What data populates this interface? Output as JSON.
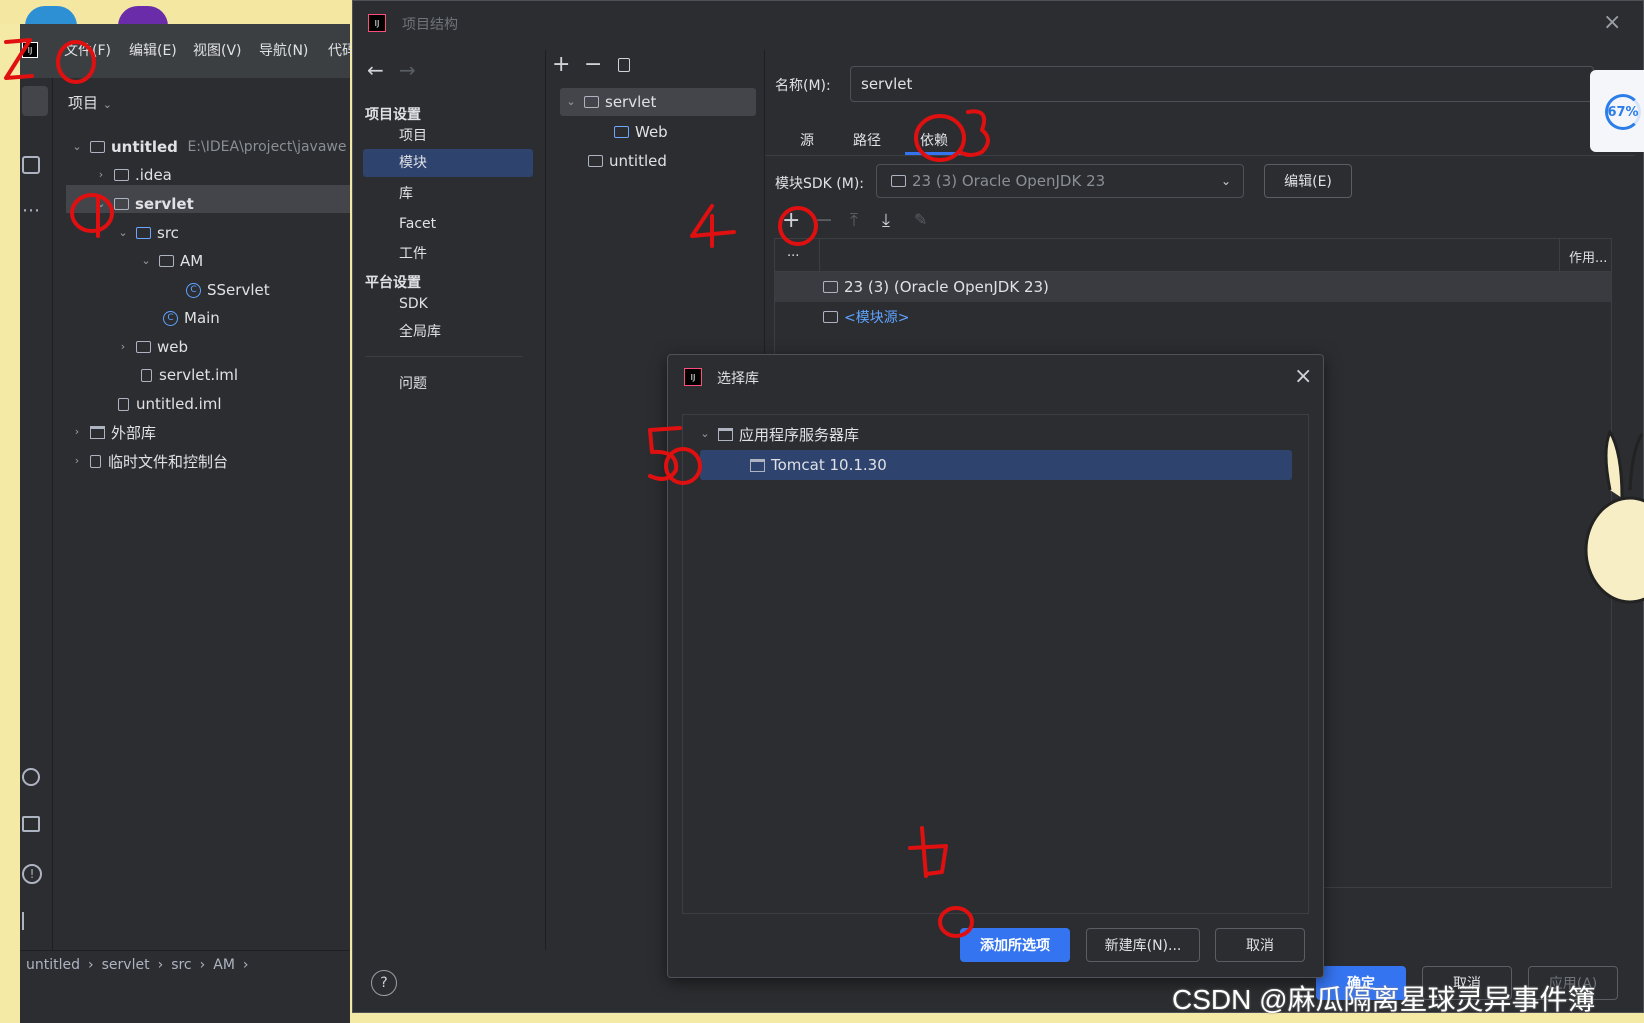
{
  "ide": {
    "menu": [
      "文件(F)",
      "编辑(E)",
      "视图(V)",
      "导航(N)",
      "代码"
    ],
    "project_label": "项目",
    "tree": [
      {
        "label": "untitled",
        "extra": "E:\\IDEA\\project\\javawe"
      },
      {
        "label": ".idea"
      },
      {
        "label": "servlet"
      },
      {
        "label": "src"
      },
      {
        "label": "AM"
      },
      {
        "label": "SServlet"
      },
      {
        "label": "Main"
      },
      {
        "label": "web"
      },
      {
        "label": "servlet.iml"
      },
      {
        "label": "untitled.iml"
      },
      {
        "label": "外部库"
      },
      {
        "label": "临时文件和控制台"
      }
    ],
    "breadcrumb": [
      "untitled",
      "servlet",
      "src",
      "AM"
    ]
  },
  "dialog": {
    "title": "项目结构",
    "project_settings_header": "项目设置",
    "project_settings": [
      "项目",
      "模块",
      "库",
      "Facet",
      "工件"
    ],
    "platform_settings_header": "平台设置",
    "platform_settings": [
      "SDK",
      "全局库"
    ],
    "problems": "问题",
    "module_tree": [
      "servlet",
      "Web",
      "untitled"
    ],
    "name_label": "名称(M):",
    "name_value": "servlet",
    "tabs": [
      "源",
      "路径",
      "依赖"
    ],
    "sdk_label": "模块SDK (M):",
    "sdk_value": "23 (3) Oracle OpenJDK 23",
    "edit_button": "编辑(E)",
    "deps_col_more": "...",
    "deps_col_scope": "作用...",
    "deps": [
      "23 (3) (Oracle OpenJDK 23)",
      "<模块源>"
    ],
    "ok": "确定",
    "cancel": "取消",
    "apply": "应用(A)",
    "help": "?"
  },
  "chooser": {
    "title": "选择库",
    "group": "应用程序服务器库",
    "item": "Tomcat 10.1.30",
    "add_selected": "添加所选项",
    "new_lib": "新建库(N)...",
    "cancel": "取消"
  },
  "overlay": {
    "progress": "67%",
    "watermark": "CSDN @麻瓜隔离星球灵异事件簿"
  }
}
